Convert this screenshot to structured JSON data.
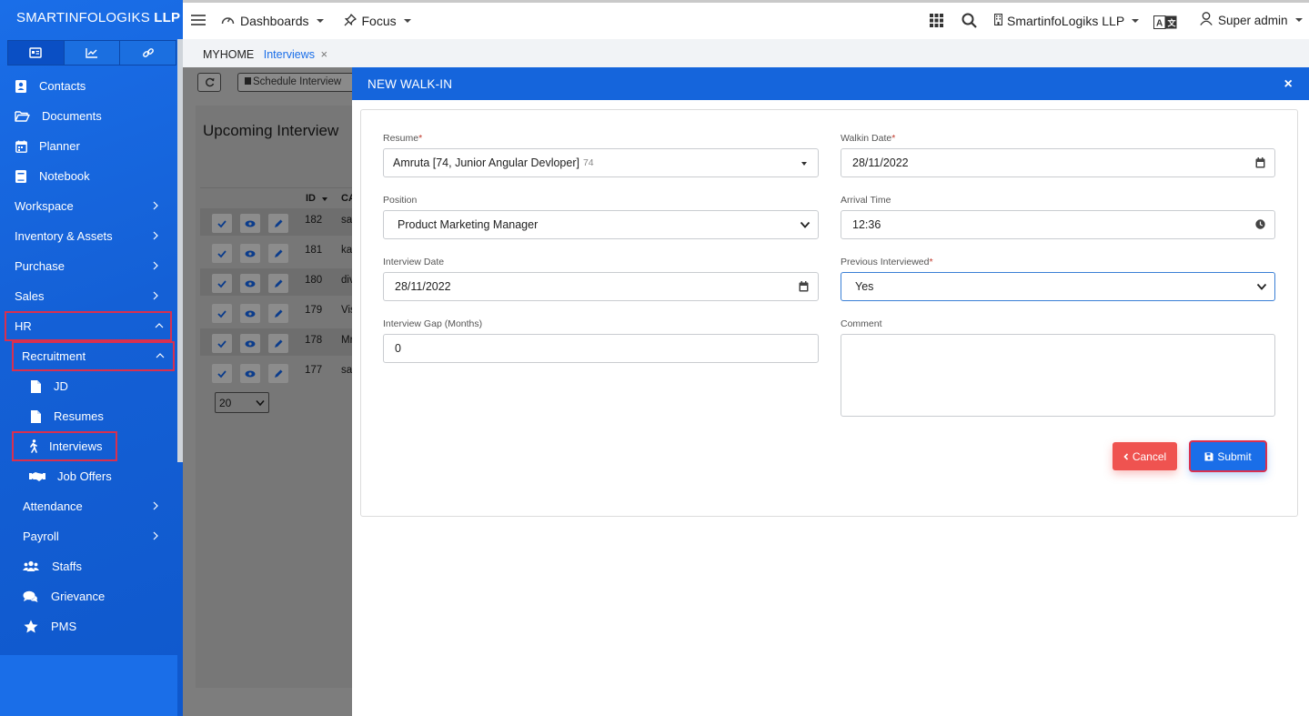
{
  "app": {
    "brand_main": "SMARTINFOLOGIKS ",
    "brand_bold": "LLP"
  },
  "sidebar": {
    "icon_tabs": [
      "id-card-icon",
      "chart-line-icon",
      "link-icon"
    ],
    "items": [
      {
        "label": "Contacts"
      },
      {
        "label": "Documents"
      },
      {
        "label": "Planner"
      },
      {
        "label": "Notebook"
      },
      {
        "label": "Workspace"
      },
      {
        "label": "Inventory & Assets"
      },
      {
        "label": "Purchase"
      },
      {
        "label": "Sales"
      },
      {
        "label": "HR"
      },
      {
        "label": "Recruitment"
      },
      {
        "label": "JD"
      },
      {
        "label": "Resumes"
      },
      {
        "label": "Interviews"
      },
      {
        "label": "Job Offers"
      },
      {
        "label": "Attendance"
      },
      {
        "label": "Payroll"
      },
      {
        "label": "Staffs"
      },
      {
        "label": "Grievance"
      },
      {
        "label": "PMS"
      }
    ]
  },
  "topbar": {
    "dashboards": "Dashboards",
    "focus": "Focus",
    "company": "SmartinfoLogiks LLP",
    "user": "Super admin"
  },
  "breadcrumb": {
    "home": "MYHOME",
    "current": "Interviews",
    "close": "×"
  },
  "background": {
    "schedule_button": "Schedule Interview",
    "heading": "Upcoming Interview",
    "col_id": "ID",
    "col_ca": "CA",
    "rows": [
      {
        "id": "182",
        "name": "sa"
      },
      {
        "id": "181",
        "name": "ka"
      },
      {
        "id": "180",
        "name": "div"
      },
      {
        "id": "179",
        "name": "Vis"
      },
      {
        "id": "178",
        "name": "Mr"
      },
      {
        "id": "177",
        "name": "sa"
      }
    ],
    "page_size": "20"
  },
  "modal": {
    "title": "NEW WALK-IN",
    "close": "×",
    "resume_label": "Resume",
    "resume_value": "Amruta [74, Junior Angular Devloper]",
    "resume_id": "74",
    "walkin_date_label": "Walkin Date",
    "walkin_date_value": "28/11/2022",
    "position_label": "Position",
    "position_value": "Product Marketing Manager",
    "arrival_time_label": "Arrival Time",
    "arrival_time_value": "12:36",
    "interview_date_label": "Interview Date",
    "interview_date_value": "28/11/2022",
    "prev_interviewed_label": "Previous Interviewed",
    "prev_interviewed_value": "Yes",
    "gap_label": "Interview Gap (Months)",
    "gap_value": "0",
    "comment_label": "Comment",
    "comment_value": "",
    "cancel_label": "Cancel",
    "submit_label": "Submit",
    "required_mark": "*"
  },
  "colors": {
    "sidebar_blue": "#1565dc",
    "modal_header": "#1565dc",
    "cancel_red": "#ef5350",
    "submit_blue": "#1a6ee8",
    "highlight": "#d9304f"
  }
}
